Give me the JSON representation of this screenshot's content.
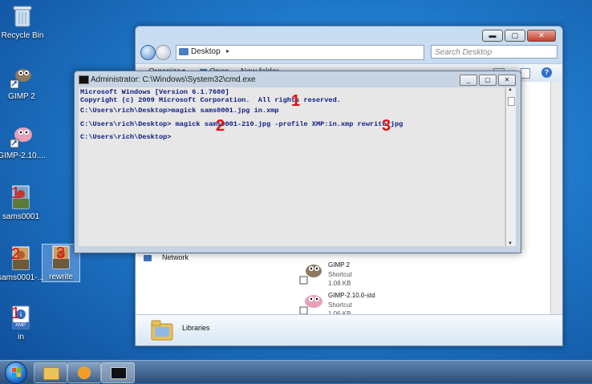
{
  "desktop": {
    "icons": [
      {
        "label": "Recycle Bin"
      },
      {
        "label": "GIMP 2"
      },
      {
        "label": "GIMP-2.10...."
      },
      {
        "label": "sams0001",
        "mark": "1"
      },
      {
        "label": "sams0001-...",
        "mark": "2"
      },
      {
        "label": "rewrite",
        "mark": "3"
      },
      {
        "label": "in",
        "mark": "1",
        "badge": "XMP"
      }
    ]
  },
  "explorer": {
    "address": "Desktop",
    "search_placeholder": "Search Desktop",
    "toolbar": {
      "organize": "Organize",
      "open": "Open",
      "new_folder": "New folder"
    },
    "nav_network": "Network",
    "items": [
      {
        "name": "GIMP 2",
        "type": "Shortcut",
        "size": "1.08 KB"
      },
      {
        "name": "GIMP-2.10.0-std",
        "type": "Shortcut",
        "size": "1.06 KB"
      }
    ],
    "libraries_label": "Libraries",
    "controls": {
      "minimize": "▬",
      "maximize": "▢",
      "close": "✕"
    }
  },
  "cmd": {
    "title": "Administrator: C:\\Windows\\System32\\cmd.exe",
    "lines": [
      "Microsoft Windows [Version 6.1.7600]",
      "Copyright (c) 2009 Microsoft Corporation.  All rights reserved.",
      "C:\\Users\\rich\\Desktop>magick sams0001.jpg in.xmp",
      "C:\\Users\\rich\\Desktop> magick sams0001-210.jpg -profile XMP:in.xmp rewrite.jpg",
      "C:\\Users\\rich\\Desktop>"
    ],
    "annotations": [
      "1",
      "2",
      "3"
    ],
    "controls": {
      "minimize": "_",
      "maximize": "▢",
      "close": "✕"
    }
  },
  "colors": {
    "annotation": "#e21010",
    "console_text": "#0c1a82",
    "console_bg": "#e7e7e7"
  }
}
